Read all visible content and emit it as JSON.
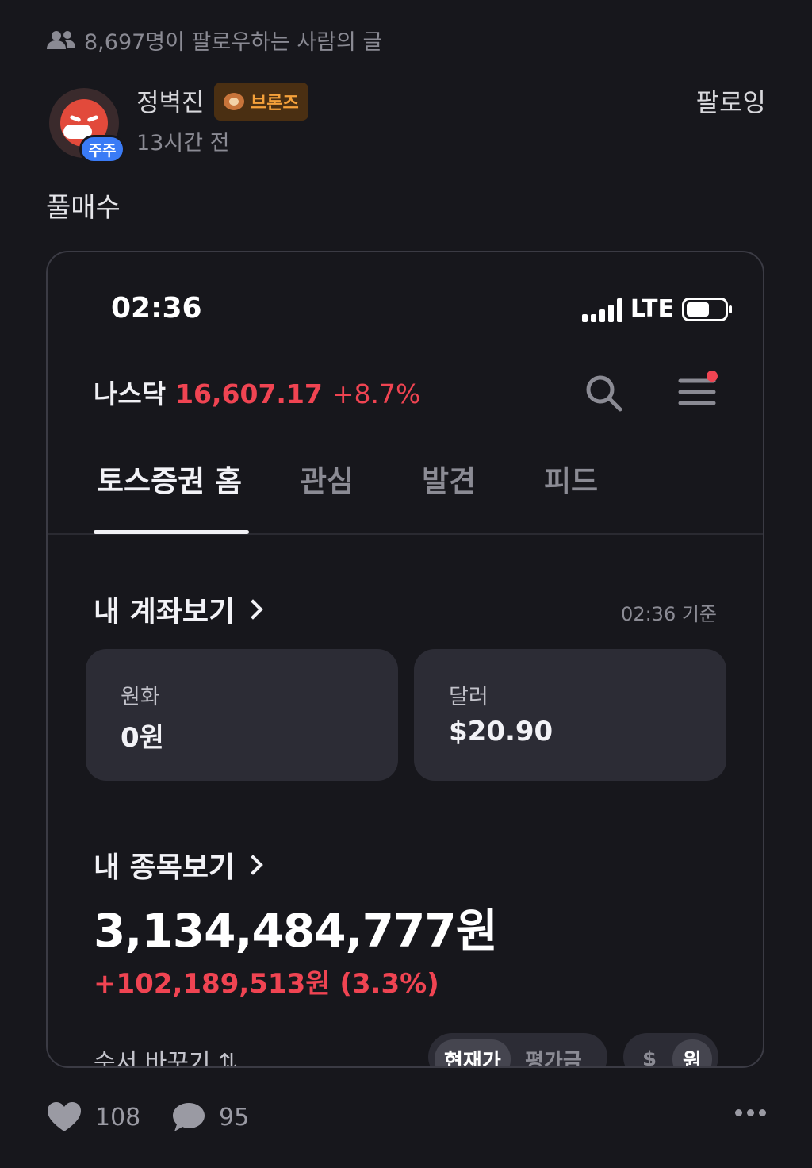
{
  "post": {
    "followers_text": "8,697명이 팔로우하는 사람의 글",
    "author": "정벽진",
    "tier_badge": "브론즈",
    "holder_badge": "주주",
    "time": "13시간 전",
    "follow_label": "팔로잉",
    "body": "풀매수",
    "likes": "108",
    "comments": "95"
  },
  "screenshot": {
    "status_time": "02:36",
    "network": "LTE",
    "index": {
      "name": "나스닥",
      "value": "16,607.17",
      "change": "+8.7%"
    },
    "tabs": [
      {
        "label": "토스증권 홈",
        "active": true
      },
      {
        "label": "관심",
        "active": false
      },
      {
        "label": "발견",
        "active": false
      },
      {
        "label": "피드",
        "active": false
      }
    ],
    "account": {
      "title": "내 계좌보기",
      "as_of": "02:36 기준",
      "krw_label": "원화",
      "krw_value": "0원",
      "usd_label": "달러",
      "usd_value": "$20.90"
    },
    "holdings": {
      "title": "내 종목보기",
      "total": "3,134,484,777원",
      "gain": "+102,189,513원 (3.3%)",
      "sort_label": "순서 바꾸기 ⇅",
      "price_toggle": [
        "현재가",
        "평가금"
      ],
      "currency_toggle": [
        "$",
        "원"
      ]
    }
  },
  "colors": {
    "background": "#17171c",
    "up_red": "#f04452",
    "bronze": "#f5a13a",
    "holder_blue": "#3a7bf6"
  }
}
